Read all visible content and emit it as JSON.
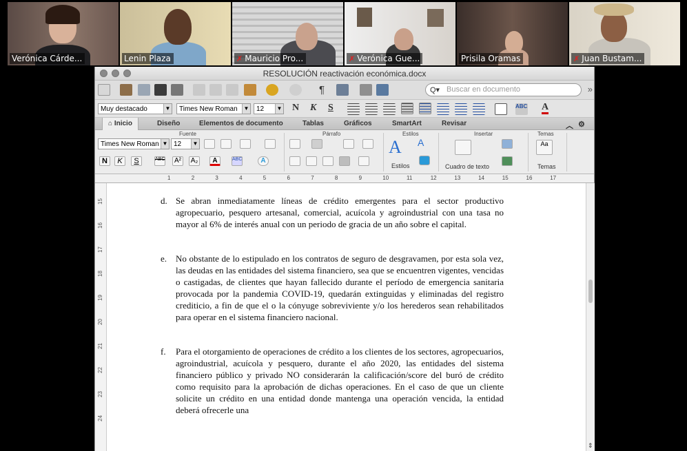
{
  "participants": [
    {
      "name": "Verónica Cárde...",
      "muted": false,
      "active": true
    },
    {
      "name": "Lenin Plaza",
      "muted": false,
      "active": false
    },
    {
      "name": "Mauricio Pro...",
      "muted": true,
      "active": false
    },
    {
      "name": "Verónica Gue...",
      "muted": true,
      "active": false
    },
    {
      "name": "Prisila Oramas",
      "muted": false,
      "active": false
    },
    {
      "name": "Juan Bustam...",
      "muted": true,
      "active": false
    }
  ],
  "word": {
    "title": "RESOLUCIÓN reactivación económica.docx",
    "search_placeholder": "Buscar en documento",
    "style_select": "Muy destacado",
    "font_select": "Times New Roman",
    "size_select": "12",
    "tabs": [
      "Inicio",
      "Diseño",
      "Elementos de documento",
      "Tablas",
      "Gráficos",
      "SmartArt",
      "Revisar"
    ],
    "selected_tab": "Inicio",
    "ribbon_groups": [
      "Fuente",
      "Párrafo",
      "Estilos",
      "Insertar",
      "Temas"
    ],
    "ribbon_font": "Times New Roman",
    "ribbon_size": "12",
    "styles_label": "Estilos",
    "textbox_label": "Cuadro de texto",
    "themes_label": "Temas",
    "ruler_numbers": [
      "1",
      "2",
      "3",
      "4",
      "5",
      "6",
      "7",
      "8",
      "9",
      "10",
      "11",
      "12",
      "13",
      "14",
      "15",
      "16",
      "17"
    ],
    "vruler_numbers": [
      "15",
      "16",
      "17",
      "18",
      "19",
      "20",
      "21",
      "22",
      "23",
      "24"
    ]
  },
  "document": {
    "items": [
      {
        "label": "d.",
        "text": "Se abran inmediatamente líneas de crédito emergentes para el sector productivo agropecuario, pesquero artesanal, comercial, acuícola y agroindustrial con una tasa no mayor al 6% de interés anual con un periodo de gracia de un año sobre el capital."
      },
      {
        "label": "e.",
        "text": "No obstante de lo estipulado en los contratos de seguro de desgravamen, por esta sola vez, las deudas en las entidades del sistema financiero, sea que se encuentren vigentes, vencidas o castigadas, de clientes que hayan fallecido durante el período de emergencia sanitaria provocada por la pandemia COVID-19, quedarán extinguidas y eliminadas del registro crediticio, a fin de que el o la cónyuge sobreviviente y/o los herederos sean rehabilitados para operar en el sistema financiero nacional."
      },
      {
        "label": "f.",
        "text": "Para el otorgamiento de operaciones de crédito a los clientes de los sectores, agropecuarios, agroindustrial, acuícola y pesquero, durante el año 2020, las entidades del sistema financiero público y privado NO considerarán la calificación/score del buró de crédito como requisito para la aprobación de dichas operaciones. En el caso de que un cliente solicite un crédito en una entidad donde mantenga una operación vencida, la entidad deberá ofrecerle una"
      }
    ]
  }
}
